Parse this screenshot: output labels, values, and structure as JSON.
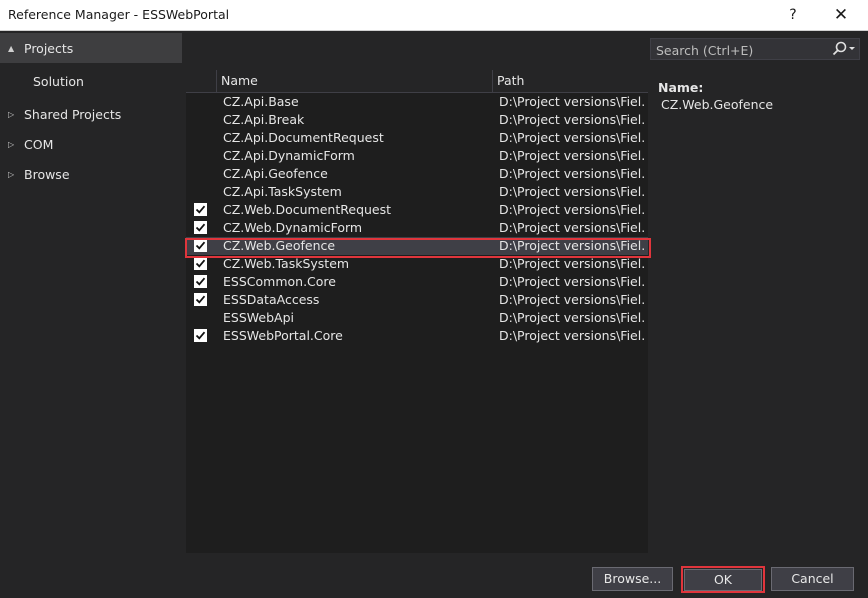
{
  "window": {
    "title": "Reference Manager - ESSWebPortal",
    "help_label": "?",
    "close_label": "✕"
  },
  "nav": {
    "items": [
      {
        "label": "Projects",
        "arrow": "▲",
        "selected": true
      },
      {
        "label": "Solution",
        "arrow": "",
        "selected": false
      },
      {
        "label": "Shared Projects",
        "arrow": "▷",
        "selected": false
      },
      {
        "label": "COM",
        "arrow": "▷",
        "selected": false
      },
      {
        "label": "Browse",
        "arrow": "▷",
        "selected": false
      }
    ]
  },
  "search": {
    "placeholder": "Search (Ctrl+E)",
    "icon": "search-icon"
  },
  "list": {
    "columns": {
      "name": "Name",
      "path": "Path"
    },
    "rows": [
      {
        "name": "CZ.Api.Base",
        "path": "D:\\Project versions\\Fiel...",
        "checked": false
      },
      {
        "name": "CZ.Api.Break",
        "path": "D:\\Project versions\\Fiel...",
        "checked": false
      },
      {
        "name": "CZ.Api.DocumentRequest",
        "path": "D:\\Project versions\\Fiel...",
        "checked": false
      },
      {
        "name": "CZ.Api.DynamicForm",
        "path": "D:\\Project versions\\Fiel...",
        "checked": false
      },
      {
        "name": "CZ.Api.Geofence",
        "path": "D:\\Project versions\\Fiel...",
        "checked": false
      },
      {
        "name": "CZ.Api.TaskSystem",
        "path": "D:\\Project versions\\Fiel...",
        "checked": false
      },
      {
        "name": "CZ.Web.DocumentRequest",
        "path": "D:\\Project versions\\Fiel...",
        "checked": true
      },
      {
        "name": "CZ.Web.DynamicForm",
        "path": "D:\\Project versions\\Fiel...",
        "checked": true
      },
      {
        "name": "CZ.Web.Geofence",
        "path": "D:\\Project versions\\Fiel...",
        "checked": true,
        "selected": true
      },
      {
        "name": "CZ.Web.TaskSystem",
        "path": "D:\\Project versions\\Fiel...",
        "checked": true
      },
      {
        "name": "ESSCommon.Core",
        "path": "D:\\Project versions\\Fiel...",
        "checked": true
      },
      {
        "name": "ESSDataAccess",
        "path": "D:\\Project versions\\Fiel...",
        "checked": true
      },
      {
        "name": "ESSWebApi",
        "path": "D:\\Project versions\\Fiel...",
        "checked": false
      },
      {
        "name": "ESSWebPortal.Core",
        "path": "D:\\Project versions\\Fiel...",
        "checked": true
      }
    ]
  },
  "details": {
    "name_label": "Name:",
    "name_value": "CZ.Web.Geofence"
  },
  "buttons": {
    "browse": "Browse...",
    "ok": "OK",
    "cancel": "Cancel"
  },
  "colors": {
    "highlight_outline": "#e0353c",
    "panel_bg": "#252526",
    "list_bg": "#1e1e1e"
  }
}
